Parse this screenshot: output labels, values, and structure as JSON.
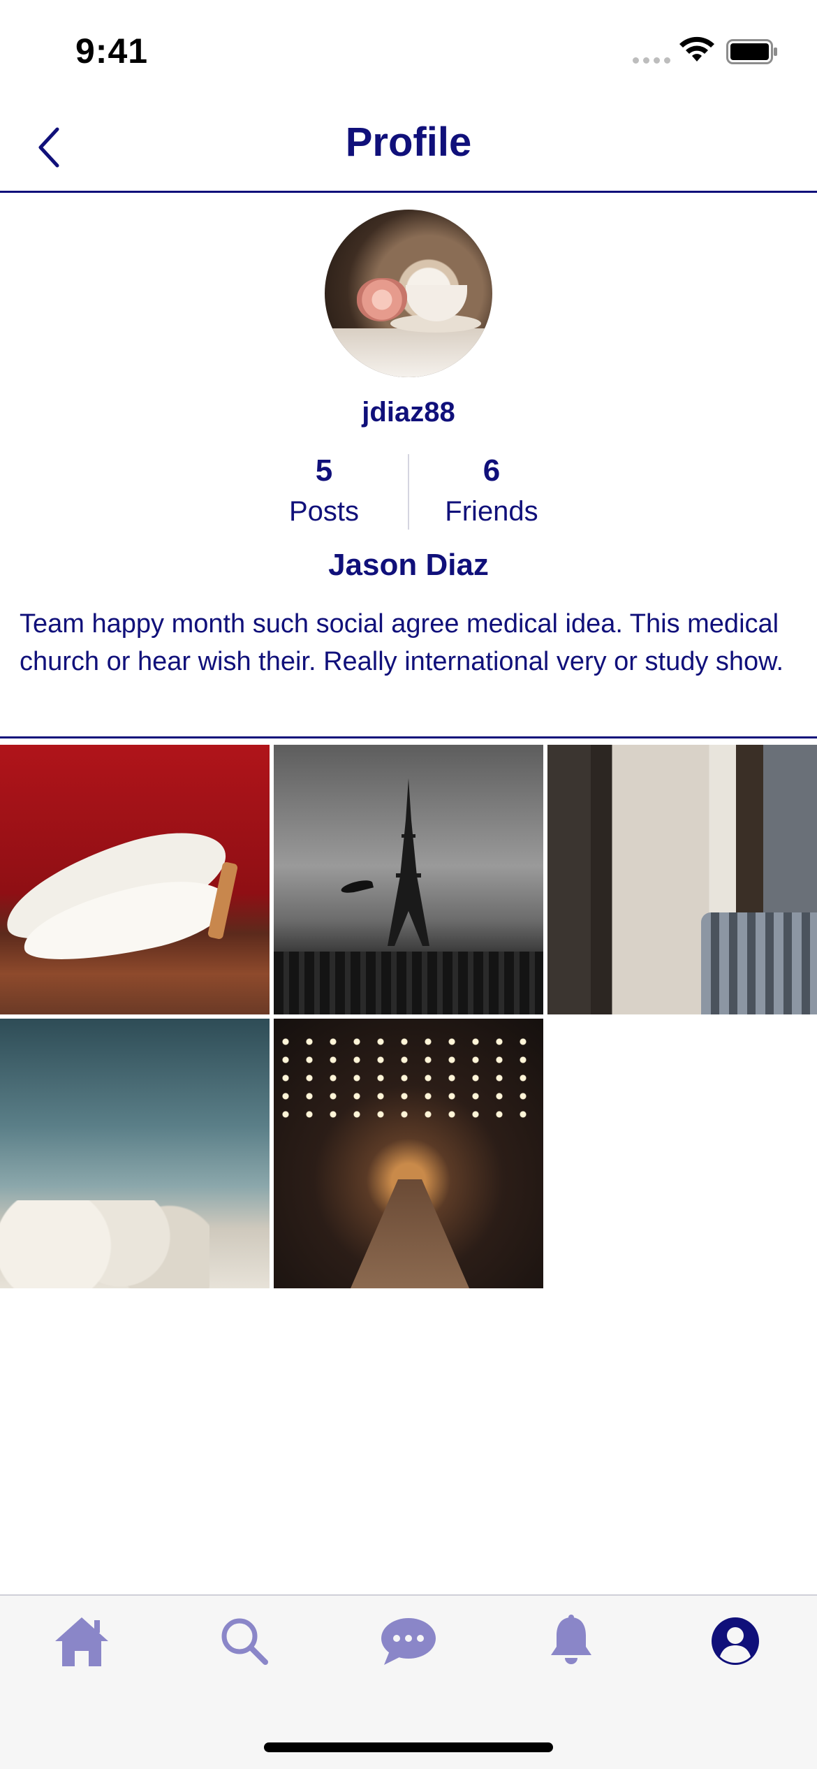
{
  "status_bar": {
    "time": "9:41",
    "icons": [
      "signal-dots-icon",
      "wifi-icon",
      "battery-icon"
    ]
  },
  "nav": {
    "title": "Profile",
    "back_icon": "chevron-left-icon"
  },
  "profile": {
    "avatar_icon": "avatar-photo",
    "username": "jdiaz88",
    "stats": [
      {
        "value": "5",
        "label": "Posts"
      },
      {
        "value": "6",
        "label": "Friends"
      }
    ],
    "full_name": "Jason Diaz",
    "bio": "Team happy month such social agree medical idea. This medical church or hear wish their. Really international very or study show."
  },
  "photos": [
    {
      "subject": "white-heels-photo"
    },
    {
      "subject": "eiffel-tower-photo"
    },
    {
      "subject": "window-chair-photo"
    },
    {
      "subject": "cloud-sky-photo"
    },
    {
      "subject": "lit-street-photo"
    }
  ],
  "tab_bar": {
    "tabs": [
      {
        "icon": "home-icon",
        "active": false
      },
      {
        "icon": "search-icon",
        "active": false
      },
      {
        "icon": "chat-bubble-icon",
        "active": false
      },
      {
        "icon": "bell-icon",
        "active": false
      },
      {
        "icon": "profile-icon",
        "active": true
      }
    ],
    "colors": {
      "active": "#10107a",
      "inactive": "#8a86c8"
    }
  },
  "colors": {
    "primary": "#10107a",
    "background": "#ffffff",
    "tab_bar_background": "#f6f6f6"
  }
}
